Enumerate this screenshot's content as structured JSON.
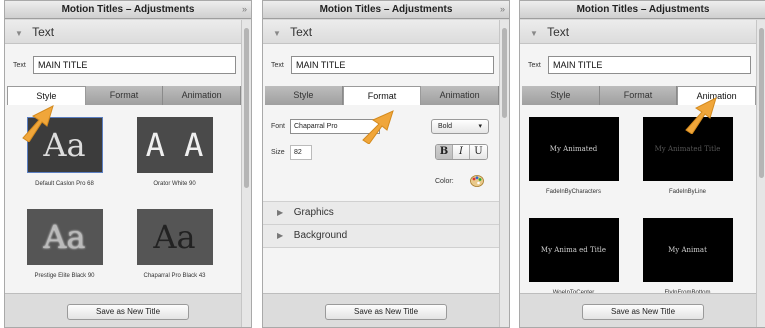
{
  "panel_title": "Motion Titles – Adjustments",
  "collapse_glyph": "»",
  "section_text": "Text",
  "text_label": "Text",
  "text_value": "MAIN TITLE",
  "tabs": [
    "Style",
    "Format",
    "Animation"
  ],
  "save_button": "Save as New Title",
  "styles": [
    {
      "sample": "Aa",
      "caption": "Default Caslon Pro 68"
    },
    {
      "sample": "A A",
      "caption": "Orator White 90"
    },
    {
      "sample": "Aa",
      "caption": "Prestige Elite Black 90"
    },
    {
      "sample": "Aa",
      "caption": "Chaparral Pro Black 43"
    }
  ],
  "format": {
    "font_label": "Font",
    "font_value": "Chaparral Pro",
    "weight_value": "Bold",
    "size_label": "Size",
    "size_value": "82",
    "bold": "B",
    "italic": "I",
    "underline": "U",
    "color_label": "Color:",
    "sections": [
      "Graphics",
      "Background"
    ]
  },
  "animations": [
    {
      "preview": "My Animated",
      "caption": "FadeInByCharacters"
    },
    {
      "preview": "My Animated Title",
      "caption": "FadeInByLine"
    },
    {
      "preview": "My Anima ed Title",
      "caption": "WoeInToCenter"
    },
    {
      "preview": "My Animat",
      "caption": "FlyInFromBottom"
    }
  ],
  "colors": {
    "accent_arrow": "#f0a63a",
    "tab_active": "#ffffff",
    "tab_inactive": "#a9a9a9"
  }
}
